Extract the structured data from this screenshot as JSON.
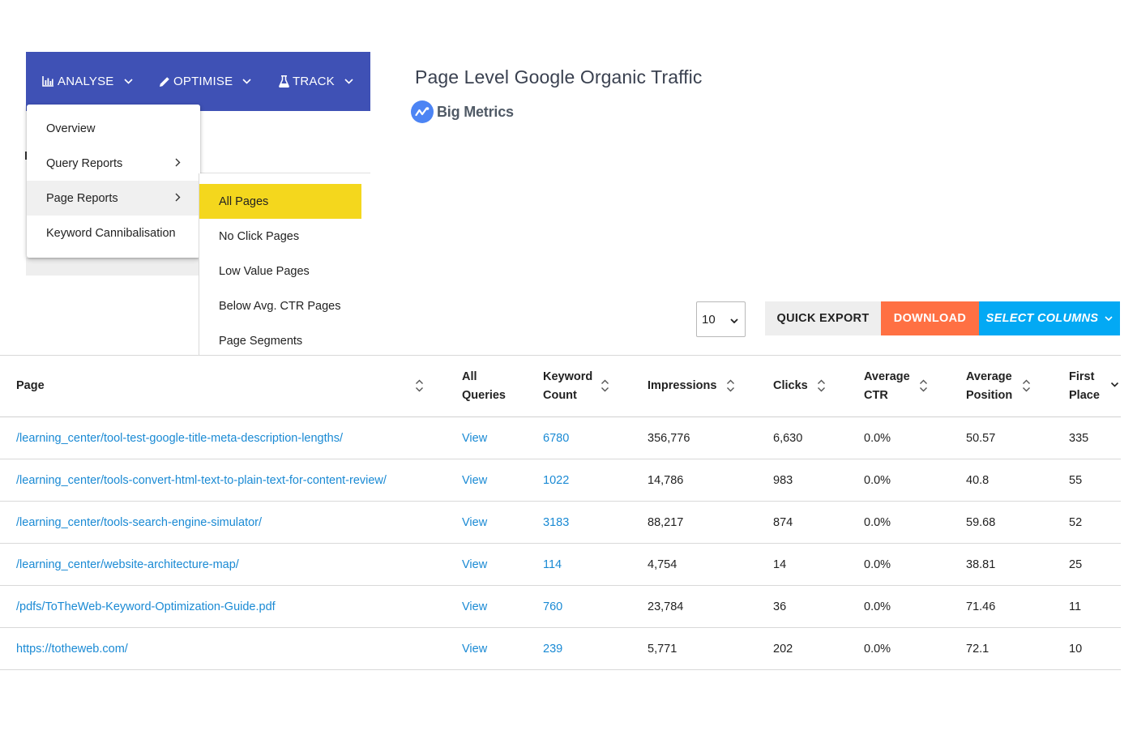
{
  "nav": {
    "analyse": "ANALYSE",
    "optimise": "OPTIMISE",
    "track": "TRACK"
  },
  "menu": {
    "items": [
      {
        "label": "Overview"
      },
      {
        "label": "Query Reports"
      },
      {
        "label": "Page Reports"
      },
      {
        "label": "Keyword Cannibalisation"
      }
    ]
  },
  "submenu": {
    "items": [
      {
        "label": "All Pages"
      },
      {
        "label": "No Click Pages"
      },
      {
        "label": "Low Value Pages"
      },
      {
        "label": "Below Avg. CTR Pages"
      },
      {
        "label": "Page Segments"
      }
    ]
  },
  "header": {
    "title": "Page Level Google Organic Traffic",
    "logo_text": "Big Metrics"
  },
  "toolbar": {
    "rows_per_page": "10",
    "quick_export": "QUICK EXPORT",
    "download": "DOWNLOAD",
    "select_columns": "SELECT COLUMNS"
  },
  "table": {
    "columns": [
      {
        "line1": "Page",
        "line2": ""
      },
      {
        "line1": "All",
        "line2": "Queries"
      },
      {
        "line1": "Keyword",
        "line2": "Count"
      },
      {
        "line1": "Impressions",
        "line2": ""
      },
      {
        "line1": "Clicks",
        "line2": ""
      },
      {
        "line1": "Average",
        "line2": "CTR"
      },
      {
        "line1": "Average",
        "line2": "Position"
      },
      {
        "line1": "First",
        "line2": "Place"
      }
    ],
    "rows": [
      {
        "page": "/learning_center/tool-test-google-title-meta-description-lengths/",
        "queries": "View",
        "keywords": "6780",
        "impressions": "356,776",
        "clicks": "6,630",
        "ctr": "0.0%",
        "position": "50.57",
        "first": "335"
      },
      {
        "page": "/learning_center/tools-convert-html-text-to-plain-text-for-content-review/",
        "queries": "View",
        "keywords": "1022",
        "impressions": "14,786",
        "clicks": "983",
        "ctr": "0.0%",
        "position": "40.8",
        "first": "55"
      },
      {
        "page": "/learning_center/tools-search-engine-simulator/",
        "queries": "View",
        "keywords": "3183",
        "impressions": "88,217",
        "clicks": "874",
        "ctr": "0.0%",
        "position": "59.68",
        "first": "52"
      },
      {
        "page": "/learning_center/website-architecture-map/",
        "queries": "View",
        "keywords": "114",
        "impressions": "4,754",
        "clicks": "14",
        "ctr": "0.0%",
        "position": "38.81",
        "first": "25"
      },
      {
        "page": "/pdfs/ToTheWeb-Keyword-Optimization-Guide.pdf",
        "queries": "View",
        "keywords": "760",
        "impressions": "23,784",
        "clicks": "36",
        "ctr": "0.0%",
        "position": "71.46",
        "first": "11"
      },
      {
        "page": "https://totheweb.com/",
        "queries": "View",
        "keywords": "239",
        "impressions": "5,771",
        "clicks": "202",
        "ctr": "0.0%",
        "position": "72.1",
        "first": "10"
      }
    ]
  },
  "colors": {
    "navbar": "#3f51b5",
    "highlight": "#f4d71d",
    "download": "#ff7043",
    "select_columns": "#03a9f4",
    "link": "#1a8ad4"
  }
}
